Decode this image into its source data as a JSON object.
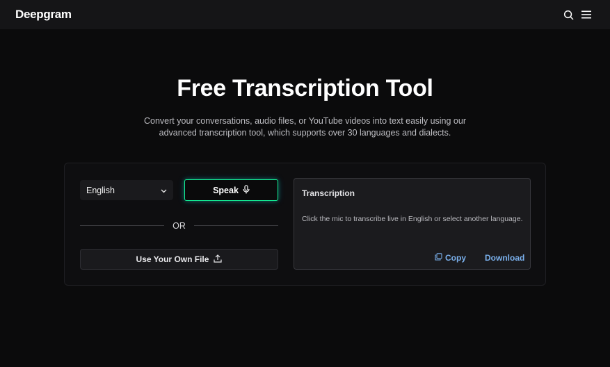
{
  "header": {
    "logo_text": "Deepgram",
    "icons": [
      "search-icon",
      "menu-icon"
    ]
  },
  "hero": {
    "title": "Free Transcription Tool",
    "subtitle_line1": "Convert your conversations, audio files, or YouTube videos into text easily using our",
    "subtitle_line2": "advanced transcription tool, which supports over 30 languages and dialects."
  },
  "controls": {
    "language_selected": "English",
    "speak_label": "Speak",
    "or_label": "OR",
    "file_button_label": "Use Your Own File"
  },
  "transcription": {
    "title": "Transcription",
    "hint": "Click the mic to transcribe live in English or select another language.",
    "copy_label": "Copy",
    "download_label": "Download"
  },
  "colors": {
    "background": "#0b0b0c",
    "topbar": "#151517",
    "accent_green": "#13ef95",
    "link_blue": "#7ab0ec"
  }
}
